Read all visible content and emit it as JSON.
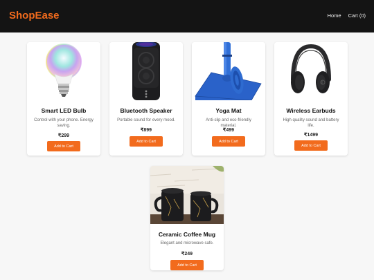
{
  "header": {
    "brand": "ShopEase",
    "nav": [
      {
        "label": "Home"
      },
      {
        "label": "Cart (0)"
      }
    ]
  },
  "products": [
    {
      "name": "Smart LED Bulb",
      "description": "Control with your phone. Energy saving.",
      "price": "₹299",
      "button": "Add to Cart",
      "image_icon": "smart-bulb-image"
    },
    {
      "name": "Bluetooth Speaker",
      "description": "Portable sound for every mood.",
      "price": "₹899",
      "button": "Add to Cart",
      "image_icon": "speaker-image"
    },
    {
      "name": "Yoga Mat",
      "description": "Anti-slip and eco-friendly material.",
      "price": "₹499",
      "button": "Add to Cart",
      "image_icon": "yoga-mat-image"
    },
    {
      "name": "Wireless Earbuds",
      "description": "High quality sound and battery life.",
      "price": "₹1499",
      "button": "Add to Cart",
      "image_icon": "headphones-image"
    },
    {
      "name": "Ceramic Coffee Mug",
      "description": "Elegant and microwave safe.",
      "price": "₹249",
      "button": "Add to Cart",
      "image_icon": "coffee-mugs-image"
    }
  ],
  "colors": {
    "accent": "#f26b1d",
    "navbar": "#141414",
    "background": "#f7f7f7"
  }
}
